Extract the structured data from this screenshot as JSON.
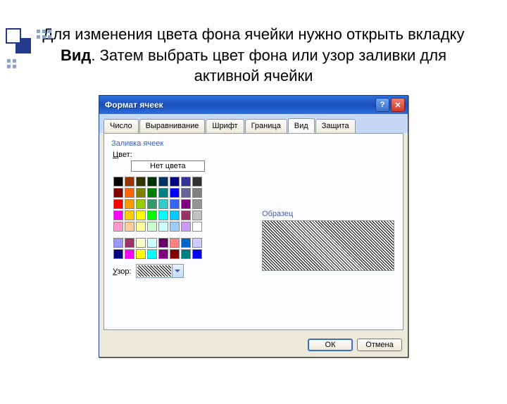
{
  "deco_dots": [
    [
      44,
      2
    ],
    [
      52,
      2
    ],
    [
      60,
      2
    ],
    [
      44,
      10
    ],
    [
      52,
      10
    ],
    [
      60,
      10
    ],
    [
      2,
      44
    ],
    [
      10,
      44
    ],
    [
      2,
      52
    ],
    [
      10,
      52
    ]
  ],
  "slide": {
    "text_before": "Для изменения цвета фона ячейки нужно открыть вкладку ",
    "text_bold": "Вид",
    "text_after": ". Затем выбрать цвет фона или узор заливки для активной ячейки"
  },
  "dialog": {
    "title": "Формат ячеек",
    "tabs": [
      "Число",
      "Выравнивание",
      "Шрифт",
      "Граница",
      "Вид",
      "Защита"
    ],
    "active_tab": 4,
    "group_fill": "Заливка ячеек",
    "label_color": "Цвет:",
    "no_color": "Нет цвета",
    "label_pattern": "Узор:",
    "label_sample": "Образец",
    "ok": "ОК",
    "cancel": "Отмена",
    "help": "?",
    "close": "✕"
  },
  "palette_main": [
    [
      "#000000",
      "#993300",
      "#333300",
      "#003300",
      "#003366",
      "#000080",
      "#333399",
      "#333333"
    ],
    [
      "#800000",
      "#ff6600",
      "#808000",
      "#008000",
      "#008080",
      "#0000ff",
      "#666699",
      "#808080"
    ],
    [
      "#ff0000",
      "#ff9900",
      "#99cc00",
      "#339966",
      "#33cccc",
      "#3366ff",
      "#800080",
      "#969696"
    ],
    [
      "#ff00ff",
      "#ffcc00",
      "#ffff00",
      "#00ff00",
      "#00ffff",
      "#00ccff",
      "#993366",
      "#c0c0c0"
    ],
    [
      "#ff99cc",
      "#ffcc99",
      "#ffff99",
      "#ccffcc",
      "#ccffff",
      "#99ccff",
      "#cc99ff",
      "#ffffff"
    ]
  ],
  "palette_extra": [
    [
      "#9999ff",
      "#993366",
      "#ffffcc",
      "#ccffff",
      "#660066",
      "#ff8080",
      "#0066cc",
      "#ccccff"
    ],
    [
      "#000080",
      "#ff00ff",
      "#ffff00",
      "#00ffff",
      "#800080",
      "#800000",
      "#008080",
      "#0000ff"
    ]
  ]
}
